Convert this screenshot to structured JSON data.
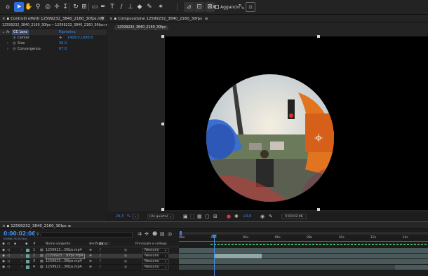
{
  "toolbar": {
    "tools": [
      "home-icon",
      "selection-icon",
      "hand-icon",
      "zoom-icon",
      "orbit-icon",
      "pan-icon",
      "dolly-icon",
      "rotate-icon",
      "rect-mask-icon",
      "pen-icon",
      "type-icon",
      "brush-icon",
      "clone-stamp-icon",
      "eraser-icon",
      "roto-brush-icon",
      "puppet-icon"
    ],
    "tools_glyphs": [
      "⌂",
      "➤",
      "✋",
      "🔍",
      "↻",
      "✛",
      "↕",
      "⟲",
      "▭",
      "✒",
      "T",
      "/",
      "⎘",
      "◇",
      "✎",
      "✶"
    ],
    "snap_label": "Aggancio"
  },
  "effects_panel": {
    "tab_label": "Controlli effetti 12599232_3840_2160_30fps.mp",
    "breadcrumb": "12599232_3840_2160_30fps • 12599232_3840_2160_30fps.mp4",
    "effect_name": "CC Lens",
    "reset_label": "Ripristina",
    "properties": [
      {
        "name": "Center",
        "value": "1409,0,1080,0"
      },
      {
        "name": "Size",
        "value": "36,0"
      },
      {
        "name": "Convergence",
        "value": "67,0"
      }
    ]
  },
  "comp_panel": {
    "tab_label": "Composizione 12599232_3840_2160_30fps",
    "comp_chip": "12599232_3840_2160_30fps",
    "zoom": "24,3",
    "zoom_unit": "%",
    "resolution": "(Un quarto)",
    "exposure": "+0,0",
    "timecode": "0:00:02:06"
  },
  "timeline": {
    "tab_label": "12599232_3840_2160_30fps",
    "timecode": "0:00:02:06",
    "frame_info": "00066 (30.00 fps)",
    "search_placeholder": "",
    "col_source": "Nome sorgente",
    "col_parent": "Principale e collega",
    "layers": [
      {
        "num": "1",
        "name": "1259923...30fps.mp4",
        "parent": "Nessuno",
        "selected": false
      },
      {
        "num": "2",
        "name": "1259923...30fps.mp4",
        "parent": "Nessuno",
        "selected": true
      },
      {
        "num": "3",
        "name": "1259923...30fps.mp4",
        "parent": "Nessuno",
        "selected": false
      },
      {
        "num": "4",
        "name": "1259923...30fps.mp4",
        "parent": "Nessuno",
        "selected": false
      }
    ],
    "ruler": [
      "00s",
      "02s",
      "04s",
      "06s",
      "08s",
      "10s",
      "12s",
      "14s"
    ]
  }
}
